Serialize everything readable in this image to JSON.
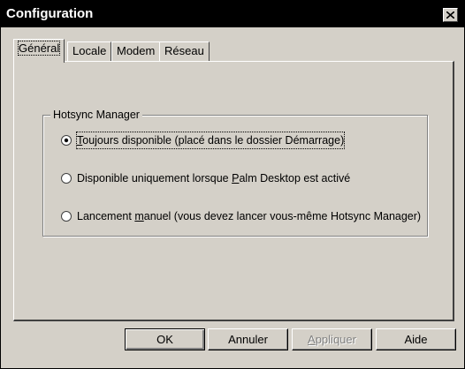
{
  "window": {
    "title": "Configuration"
  },
  "tabs": [
    {
      "label": "Général",
      "active": true
    },
    {
      "label": "Locale",
      "active": false
    },
    {
      "label": "Modem",
      "active": false
    },
    {
      "label": "Réseau",
      "active": false
    }
  ],
  "group": {
    "label": "Hotsync Manager",
    "options": [
      {
        "pre": "",
        "accel": "T",
        "post": "oujours disponible (placé dans le dossier Démarrage)",
        "selected": true
      },
      {
        "pre": "Disponible uniquement lorsque ",
        "accel": "P",
        "post": "alm Desktop est activé",
        "selected": false
      },
      {
        "pre": "Lancement ",
        "accel": "m",
        "post": "anuel (vous devez lancer vous-même Hotsync Manager)",
        "selected": false
      }
    ]
  },
  "buttons": {
    "ok": "OK",
    "cancel": "Annuler",
    "apply_pre": "",
    "apply_accel": "A",
    "apply_post": "ppliquer",
    "help": "Aide"
  },
  "icons": {
    "close": "close-icon"
  }
}
